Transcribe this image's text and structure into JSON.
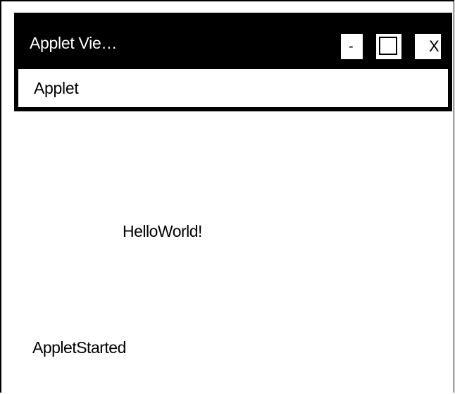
{
  "window": {
    "title": "Applet Vie…",
    "minimize_label": "-",
    "close_label": "X"
  },
  "menu": {
    "items": [
      {
        "label": "Applet"
      }
    ]
  },
  "applet": {
    "text": "HelloWorld!"
  },
  "status_bar": {
    "text": "AppletStarted"
  },
  "colors": {
    "titlebar": "#000000",
    "background": "#ffffff",
    "text": "#000000"
  }
}
